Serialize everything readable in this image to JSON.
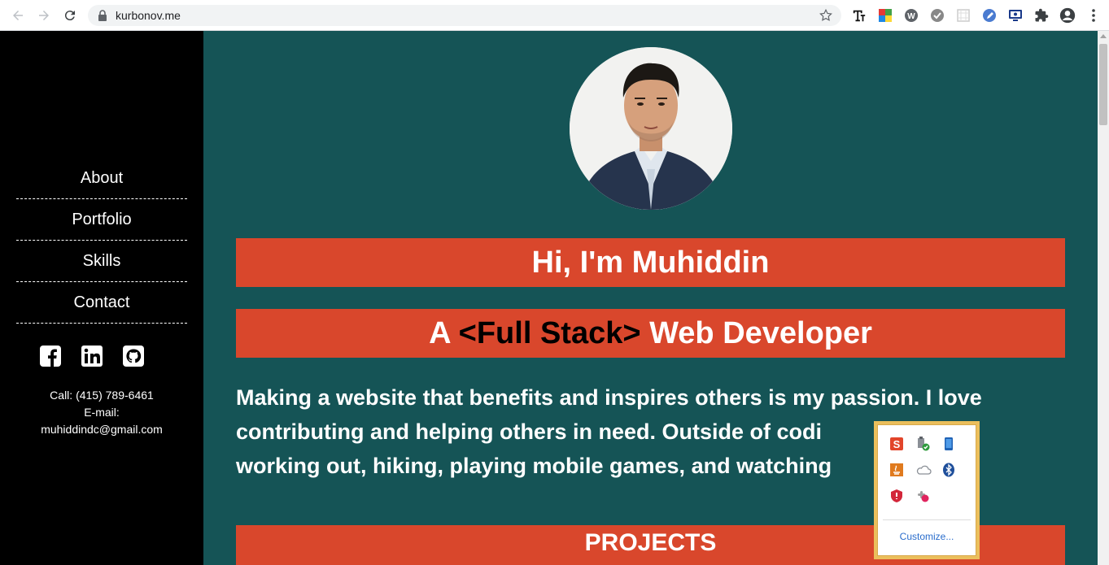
{
  "browser": {
    "url": "kurbonov.me",
    "icons": [
      "back-icon",
      "forward-icon",
      "reload-icon",
      "lock-icon",
      "star-icon",
      "extensions-icon",
      "profile-icon"
    ]
  },
  "sidebar": {
    "nav": [
      {
        "label": "About"
      },
      {
        "label": "Portfolio"
      },
      {
        "label": "Skills"
      },
      {
        "label": "Contact"
      }
    ],
    "social_icons": [
      "facebook-icon",
      "linkedin-icon",
      "github-icon"
    ],
    "call": "Call: (415) 789-6461",
    "email_label": "E-mail:",
    "email": "muhiddindc@gmail.com"
  },
  "main": {
    "greeting": "Hi, I'm Muhiddin",
    "role_prefix": "A ",
    "role_tag": "<Full Stack>",
    "role_suffix": " Web Developer",
    "intro": "Making a website that benefits and inspires others is my passion. I love contributing and helping others in need. Outside of codi",
    "intro_line3": "working out, hiking, playing mobile games, and watching",
    "projects_heading": "PROJECTS"
  },
  "tray": {
    "customize": "Customize..."
  },
  "colors": {
    "main_bg": "#155456",
    "banner": "#d9472c",
    "sidebar_bg": "#000000",
    "tray_border": "#ebbf5c"
  }
}
